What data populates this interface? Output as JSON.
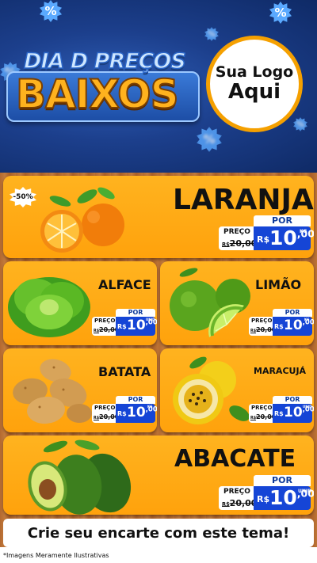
{
  "hero": {
    "title_line1": "DIA D PREÇOS",
    "title_line2": "BAIXOS",
    "logo_line1": "Sua Logo",
    "logo_line2": "Aqui",
    "badge_symbol": "%"
  },
  "products": [
    {
      "name": "LARANJA",
      "badge": "-50%",
      "por": "POR",
      "preco_label": "PREÇO",
      "old_prefix": "R$",
      "old_price": "20,00",
      "currency": "R$",
      "price_int": "10",
      "price_dec": ",00",
      "unit": "KG"
    },
    {
      "name": "ALFACE",
      "por": "POR",
      "preco_label": "PREÇO",
      "old_prefix": "R$",
      "old_price": "20,00",
      "currency": "R$",
      "price_int": "10",
      "price_dec": ",00",
      "unit": "UNID"
    },
    {
      "name": "LIMÃO",
      "por": "POR",
      "preco_label": "PREÇO",
      "old_prefix": "R$",
      "old_price": "20,00",
      "currency": "R$",
      "price_int": "10",
      "price_dec": ",00",
      "unit": "KG"
    },
    {
      "name": "BATATA",
      "por": "POR",
      "preco_label": "PREÇO",
      "old_prefix": "R$",
      "old_price": "20,00",
      "currency": "R$",
      "price_int": "10",
      "price_dec": ",00",
      "unit": "KG"
    },
    {
      "name": "MARACUJÁ",
      "por": "POR",
      "preco_label": "PREÇO",
      "old_prefix": "R$",
      "old_price": "20,00",
      "currency": "R$",
      "price_int": "10",
      "price_dec": ",00",
      "unit": "UNID"
    },
    {
      "name": "ABACATE",
      "por": "POR",
      "preco_label": "PREÇO",
      "old_prefix": "R$",
      "old_price": "20,00",
      "currency": "R$",
      "price_int": "10",
      "price_dec": ",00",
      "unit": "UNID"
    }
  ],
  "cta": "Crie seu encarte com este tema!",
  "footnote": "*Imagens Meramente Ilustrativas",
  "colors": {
    "hero_blue": "#1c3f8c",
    "card_orange": "#ffa20c",
    "price_blue": "#1545d6",
    "logo_ring": "#f5a000",
    "wood": "#b46a30"
  }
}
